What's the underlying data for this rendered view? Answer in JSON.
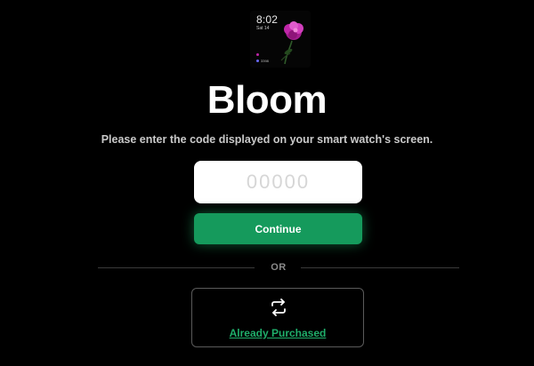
{
  "watch_preview": {
    "time": "8:02",
    "date": "Sat 14",
    "complication_1": "",
    "complication_2": "3398"
  },
  "app": {
    "title": "Bloom"
  },
  "instructions": "Please enter the code displayed on your smart watch's screen.",
  "code_input": {
    "value": "",
    "placeholder": "00000"
  },
  "continue_button": {
    "label": "Continue"
  },
  "divider": {
    "label": "OR"
  },
  "already_purchased": {
    "label": "Already Purchased",
    "icon": "restore-icon"
  },
  "colors": {
    "background": "#000000",
    "accent_green": "#159a5c",
    "link_green": "#1fae6a",
    "flower_pink": "#c026a8"
  }
}
